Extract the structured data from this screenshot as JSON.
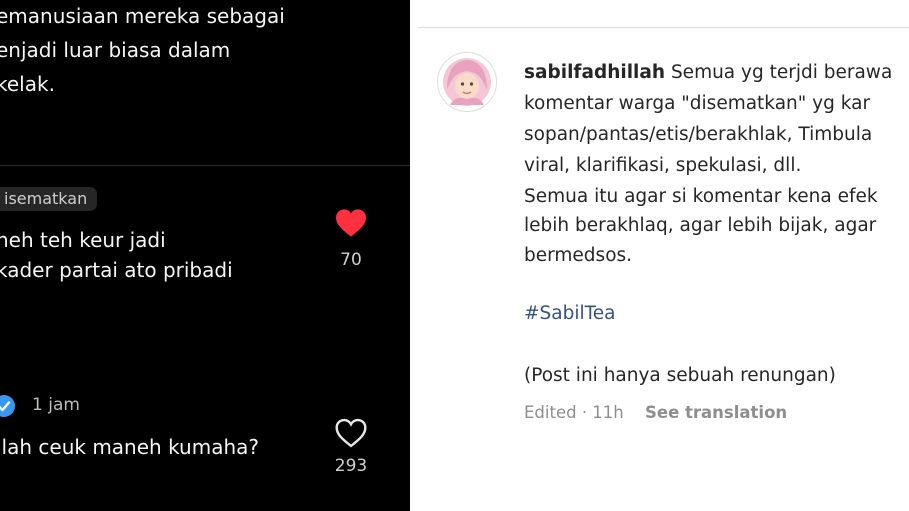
{
  "left_panel": {
    "caption_lines": [
      "emanusiaan mereka sebagai",
      "enjadi luar biasa dalam",
      "kelak."
    ],
    "pinned_comment": {
      "badge": "isematkan",
      "lines": [
        "neh teh keur jadi",
        "kader partai ato pribadi"
      ],
      "likes": "70",
      "liked": true
    },
    "second_comment": {
      "time": "1 jam",
      "text": "llah ceuk maneh kumaha?",
      "likes": "293",
      "liked": false
    }
  },
  "post": {
    "username": "sabilfadhillah",
    "lines": [
      "Semua yg terjdi berawa",
      "komentar warga \"disematkan\" yg kar",
      "sopan/pantas/etis/berakhlak, Timbula",
      "viral, klarifikasi, spekulasi, dll.",
      "Semua itu agar si komentar kena efek",
      "lebih berakhlaq, agar lebih bijak, agar",
      "bermedsos."
    ],
    "hashtag": "#SabilTea",
    "footer_note": "(Post ini hanya sebuah renungan)",
    "edited": "Edited · 11h",
    "see_translation": "See translation"
  },
  "colors": {
    "heart_liked": "#ff3040",
    "hashtag": "#385185",
    "dark_bg": "#000000"
  }
}
